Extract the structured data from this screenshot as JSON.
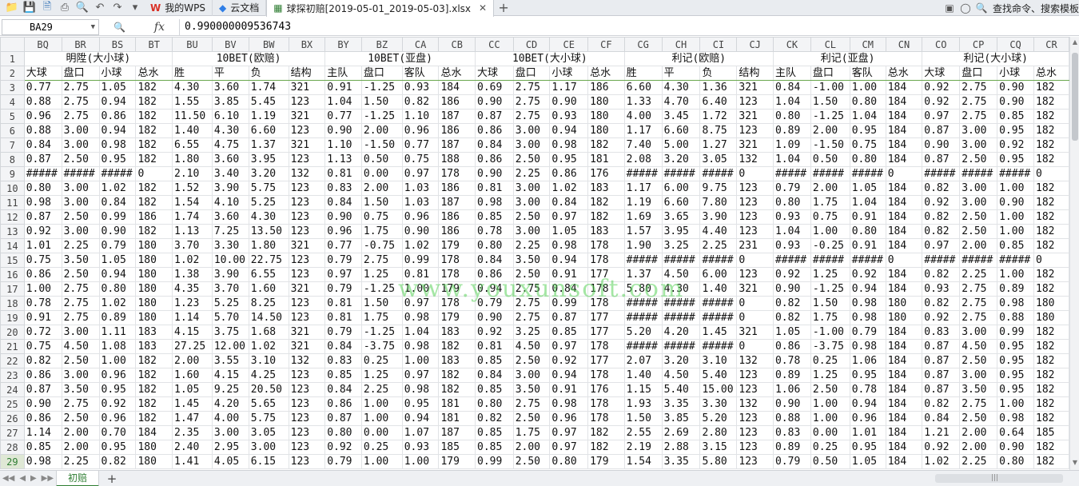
{
  "titlebar": {
    "tabs": [
      {
        "label": "我的WPS",
        "icon": "wps-logo-icon"
      },
      {
        "label": "云文档",
        "icon": "cloud-doc-icon"
      },
      {
        "label": "球探初赔[2019-05-01_2019-05-03].xlsx",
        "icon": "excel-file-icon"
      }
    ],
    "search_label": "查找命令、搜索模板"
  },
  "formula_bar": {
    "cell_ref": "BA29",
    "fx": "fx",
    "content": "0.990000009536743"
  },
  "sheet": {
    "columns": [
      "BQ",
      "BR",
      "BS",
      "BT",
      "BU",
      "BV",
      "BW",
      "BX",
      "BY",
      "BZ",
      "CA",
      "CB",
      "CC",
      "CD",
      "CE",
      "CF",
      "CG",
      "CH",
      "CI",
      "CJ",
      "CK",
      "CL",
      "CM",
      "CN",
      "CO",
      "CP",
      "CQ",
      "CR"
    ],
    "col_widths": [
      47,
      47,
      46,
      46,
      50,
      46,
      50,
      46,
      46,
      51,
      46,
      46,
      48,
      46,
      48,
      46,
      47,
      48,
      46,
      46,
      47,
      49,
      45,
      46,
      47,
      47,
      46,
      44
    ],
    "row1": [
      {
        "label": "明陞(大小球)",
        "span": 4
      },
      {
        "label": "10BET(欧赔)",
        "span": 4
      },
      {
        "label": "10BET(亚盘)",
        "span": 4
      },
      {
        "label": "10BET(大小球)",
        "span": 4
      },
      {
        "label": "利记(欧赔)",
        "span": 4
      },
      {
        "label": "利记(亚盘)",
        "span": 4
      },
      {
        "label": "利记(大小球)",
        "span": 4
      }
    ],
    "row2": [
      "大球",
      "盘口",
      "小球",
      "总水",
      "胜",
      "平",
      "负",
      "结构",
      "主队",
      "盘口",
      "客队",
      "总水",
      "大球",
      "盘口",
      "小球",
      "总水",
      "胜",
      "平",
      "负",
      "结构",
      "主队",
      "盘口",
      "客队",
      "总水",
      "大球",
      "盘口",
      "小球",
      "总水"
    ],
    "rows": [
      {
        "n": 3,
        "cells": [
          "0.77",
          "2.75",
          "1.05",
          "182",
          "4.30",
          "3.60",
          "1.74",
          "321",
          "0.91",
          "-1.25",
          "0.93",
          "184",
          "0.69",
          "2.75",
          "1.17",
          "186",
          "6.60",
          "4.30",
          "1.36",
          "321",
          "0.84",
          "-1.00",
          "1.00",
          "184",
          "0.92",
          "2.75",
          "0.90",
          "182"
        ]
      },
      {
        "n": 4,
        "cells": [
          "0.88",
          "2.75",
          "0.94",
          "182",
          "1.55",
          "3.85",
          "5.45",
          "123",
          "1.04",
          "1.50",
          "0.82",
          "186",
          "0.90",
          "2.75",
          "0.90",
          "180",
          "1.33",
          "4.70",
          "6.40",
          "123",
          "1.04",
          "1.50",
          "0.80",
          "184",
          "0.92",
          "2.75",
          "0.90",
          "182"
        ]
      },
      {
        "n": 5,
        "cells": [
          "0.96",
          "2.75",
          "0.86",
          "182",
          "11.50",
          "6.10",
          "1.19",
          "321",
          "0.77",
          "-1.25",
          "1.10",
          "187",
          "0.87",
          "2.75",
          "0.93",
          "180",
          "4.00",
          "3.45",
          "1.72",
          "321",
          "0.80",
          "-1.25",
          "1.04",
          "184",
          "0.97",
          "2.75",
          "0.85",
          "182"
        ]
      },
      {
        "n": 6,
        "cells": [
          "0.88",
          "3.00",
          "0.94",
          "182",
          "1.40",
          "4.30",
          "6.60",
          "123",
          "0.90",
          "2.00",
          "0.96",
          "186",
          "0.86",
          "3.00",
          "0.94",
          "180",
          "1.17",
          "6.60",
          "8.75",
          "123",
          "0.89",
          "2.00",
          "0.95",
          "184",
          "0.87",
          "3.00",
          "0.95",
          "182"
        ]
      },
      {
        "n": 7,
        "cells": [
          "0.84",
          "3.00",
          "0.98",
          "182",
          "6.55",
          "4.75",
          "1.37",
          "321",
          "1.10",
          "-1.50",
          "0.77",
          "187",
          "0.84",
          "3.00",
          "0.98",
          "182",
          "7.40",
          "5.00",
          "1.27",
          "321",
          "1.09",
          "-1.50",
          "0.75",
          "184",
          "0.90",
          "3.00",
          "0.92",
          "182"
        ]
      },
      {
        "n": 8,
        "cells": [
          "0.87",
          "2.50",
          "0.95",
          "182",
          "1.80",
          "3.60",
          "3.95",
          "123",
          "1.13",
          "0.50",
          "0.75",
          "188",
          "0.86",
          "2.50",
          "0.95",
          "181",
          "2.08",
          "3.20",
          "3.05",
          "132",
          "1.04",
          "0.50",
          "0.80",
          "184",
          "0.87",
          "2.50",
          "0.95",
          "182"
        ]
      },
      {
        "n": 9,
        "cells": [
          "#####",
          "#####",
          "#####",
          "0",
          "2.10",
          "3.40",
          "3.20",
          "132",
          "0.81",
          "0.00",
          "0.97",
          "178",
          "0.90",
          "2.25",
          "0.86",
          "176",
          "#####",
          "#####",
          "#####",
          "0",
          "#####",
          "#####",
          "#####",
          "0",
          "#####",
          "#####",
          "#####",
          "0"
        ]
      },
      {
        "n": 10,
        "cells": [
          "0.80",
          "3.00",
          "1.02",
          "182",
          "1.52",
          "3.90",
          "5.75",
          "123",
          "0.83",
          "2.00",
          "1.03",
          "186",
          "0.81",
          "3.00",
          "1.02",
          "183",
          "1.17",
          "6.00",
          "9.75",
          "123",
          "0.79",
          "2.00",
          "1.05",
          "184",
          "0.82",
          "3.00",
          "1.00",
          "182"
        ]
      },
      {
        "n": 11,
        "cells": [
          "0.98",
          "3.00",
          "0.84",
          "182",
          "1.54",
          "4.10",
          "5.25",
          "123",
          "0.84",
          "1.50",
          "1.03",
          "187",
          "0.98",
          "3.00",
          "0.84",
          "182",
          "1.19",
          "6.60",
          "7.80",
          "123",
          "0.80",
          "1.75",
          "1.04",
          "184",
          "0.92",
          "3.00",
          "0.90",
          "182"
        ]
      },
      {
        "n": 12,
        "cells": [
          "0.87",
          "2.50",
          "0.99",
          "186",
          "1.74",
          "3.60",
          "4.30",
          "123",
          "0.90",
          "0.75",
          "0.96",
          "186",
          "0.85",
          "2.50",
          "0.97",
          "182",
          "1.69",
          "3.65",
          "3.90",
          "123",
          "0.93",
          "0.75",
          "0.91",
          "184",
          "0.82",
          "2.50",
          "1.00",
          "182"
        ]
      },
      {
        "n": 13,
        "cells": [
          "0.92",
          "3.00",
          "0.90",
          "182",
          "1.13",
          "7.25",
          "13.50",
          "123",
          "0.96",
          "1.75",
          "0.90",
          "186",
          "0.78",
          "3.00",
          "1.05",
          "183",
          "1.57",
          "3.95",
          "4.40",
          "123",
          "1.04",
          "1.00",
          "0.80",
          "184",
          "0.82",
          "2.50",
          "1.00",
          "182"
        ]
      },
      {
        "n": 14,
        "cells": [
          "1.01",
          "2.25",
          "0.79",
          "180",
          "3.70",
          "3.30",
          "1.80",
          "321",
          "0.77",
          "-0.75",
          "1.02",
          "179",
          "0.80",
          "2.25",
          "0.98",
          "178",
          "1.90",
          "3.25",
          "2.25",
          "231",
          "0.93",
          "-0.25",
          "0.91",
          "184",
          "0.97",
          "2.00",
          "0.85",
          "182"
        ]
      },
      {
        "n": 15,
        "cells": [
          "0.75",
          "3.50",
          "1.05",
          "180",
          "1.02",
          "10.00",
          "22.75",
          "123",
          "0.79",
          "2.75",
          "0.99",
          "178",
          "0.84",
          "3.50",
          "0.94",
          "178",
          "#####",
          "#####",
          "#####",
          "0",
          "#####",
          "#####",
          "#####",
          "0",
          "#####",
          "#####",
          "#####",
          "0"
        ]
      },
      {
        "n": 16,
        "cells": [
          "0.86",
          "2.50",
          "0.94",
          "180",
          "1.38",
          "3.90",
          "6.55",
          "123",
          "0.97",
          "1.25",
          "0.81",
          "178",
          "0.86",
          "2.50",
          "0.91",
          "177",
          "1.37",
          "4.50",
          "6.00",
          "123",
          "0.92",
          "1.25",
          "0.92",
          "184",
          "0.82",
          "2.25",
          "1.00",
          "182"
        ]
      },
      {
        "n": 17,
        "cells": [
          "1.00",
          "2.75",
          "0.80",
          "180",
          "4.35",
          "3.70",
          "1.60",
          "321",
          "0.79",
          "-1.25",
          "1.00",
          "179",
          "0.94",
          "2.75",
          "0.84",
          "178",
          "5.80",
          "4.30",
          "1.40",
          "321",
          "0.90",
          "-1.25",
          "0.94",
          "184",
          "0.93",
          "2.75",
          "0.89",
          "182"
        ]
      },
      {
        "n": 18,
        "cells": [
          "0.78",
          "2.75",
          "1.02",
          "180",
          "1.23",
          "5.25",
          "8.25",
          "123",
          "0.81",
          "1.50",
          "0.97",
          "178",
          "0.79",
          "2.75",
          "0.99",
          "178",
          "#####",
          "#####",
          "#####",
          "0",
          "0.82",
          "1.50",
          "0.98",
          "180",
          "0.82",
          "2.75",
          "0.98",
          "180"
        ]
      },
      {
        "n": 19,
        "cells": [
          "0.91",
          "2.75",
          "0.89",
          "180",
          "1.14",
          "5.70",
          "14.50",
          "123",
          "0.81",
          "1.75",
          "0.98",
          "179",
          "0.90",
          "2.75",
          "0.87",
          "177",
          "#####",
          "#####",
          "#####",
          "0",
          "0.82",
          "1.75",
          "0.98",
          "180",
          "0.92",
          "2.75",
          "0.88",
          "180"
        ]
      },
      {
        "n": 20,
        "cells": [
          "0.72",
          "3.00",
          "1.11",
          "183",
          "4.15",
          "3.75",
          "1.68",
          "321",
          "0.79",
          "-1.25",
          "1.04",
          "183",
          "0.92",
          "3.25",
          "0.85",
          "177",
          "5.20",
          "4.20",
          "1.45",
          "321",
          "1.05",
          "-1.00",
          "0.79",
          "184",
          "0.83",
          "3.00",
          "0.99",
          "182"
        ]
      },
      {
        "n": 21,
        "cells": [
          "0.75",
          "4.50",
          "1.08",
          "183",
          "27.25",
          "12.00",
          "1.02",
          "321",
          "0.84",
          "-3.75",
          "0.98",
          "182",
          "0.81",
          "4.50",
          "0.97",
          "178",
          "#####",
          "#####",
          "#####",
          "0",
          "0.86",
          "-3.75",
          "0.98",
          "184",
          "0.87",
          "4.50",
          "0.95",
          "182"
        ]
      },
      {
        "n": 22,
        "cells": [
          "0.82",
          "2.50",
          "1.00",
          "182",
          "2.00",
          "3.55",
          "3.10",
          "132",
          "0.83",
          "0.25",
          "1.00",
          "183",
          "0.85",
          "2.50",
          "0.92",
          "177",
          "2.07",
          "3.20",
          "3.10",
          "132",
          "0.78",
          "0.25",
          "1.06",
          "184",
          "0.87",
          "2.50",
          "0.95",
          "182"
        ]
      },
      {
        "n": 23,
        "cells": [
          "0.86",
          "3.00",
          "0.96",
          "182",
          "1.60",
          "4.15",
          "4.25",
          "123",
          "0.85",
          "1.25",
          "0.97",
          "182",
          "0.84",
          "3.00",
          "0.94",
          "178",
          "1.40",
          "4.50",
          "5.40",
          "123",
          "0.89",
          "1.25",
          "0.95",
          "184",
          "0.87",
          "3.00",
          "0.95",
          "182"
        ]
      },
      {
        "n": 24,
        "cells": [
          "0.87",
          "3.50",
          "0.95",
          "182",
          "1.05",
          "9.25",
          "20.50",
          "123",
          "0.84",
          "2.25",
          "0.98",
          "182",
          "0.85",
          "3.50",
          "0.91",
          "176",
          "1.15",
          "5.40",
          "15.00",
          "123",
          "1.06",
          "2.50",
          "0.78",
          "184",
          "0.87",
          "3.50",
          "0.95",
          "182"
        ]
      },
      {
        "n": 25,
        "cells": [
          "0.90",
          "2.75",
          "0.92",
          "182",
          "1.45",
          "4.20",
          "5.65",
          "123",
          "0.86",
          "1.00",
          "0.95",
          "181",
          "0.80",
          "2.75",
          "0.98",
          "178",
          "1.93",
          "3.35",
          "3.30",
          "132",
          "0.90",
          "1.00",
          "0.94",
          "184",
          "0.82",
          "2.75",
          "1.00",
          "182"
        ]
      },
      {
        "n": 26,
        "cells": [
          "0.86",
          "2.50",
          "0.96",
          "182",
          "1.47",
          "4.00",
          "5.75",
          "123",
          "0.87",
          "1.00",
          "0.94",
          "181",
          "0.82",
          "2.50",
          "0.96",
          "178",
          "1.50",
          "3.85",
          "5.20",
          "123",
          "0.88",
          "1.00",
          "0.96",
          "184",
          "0.84",
          "2.50",
          "0.98",
          "182"
        ]
      },
      {
        "n": 27,
        "cells": [
          "1.14",
          "2.00",
          "0.70",
          "184",
          "2.35",
          "3.00",
          "3.05",
          "123",
          "0.80",
          "0.00",
          "1.07",
          "187",
          "0.85",
          "1.75",
          "0.97",
          "182",
          "2.55",
          "2.69",
          "2.80",
          "123",
          "0.83",
          "0.00",
          "1.01",
          "184",
          "1.21",
          "2.00",
          "0.64",
          "185"
        ]
      },
      {
        "n": 28,
        "cells": [
          "0.85",
          "2.00",
          "0.95",
          "180",
          "2.40",
          "2.95",
          "3.00",
          "123",
          "0.92",
          "0.25",
          "0.93",
          "185",
          "0.85",
          "2.00",
          "0.97",
          "182",
          "2.19",
          "2.88",
          "3.15",
          "123",
          "0.89",
          "0.25",
          "0.95",
          "184",
          "0.92",
          "2.00",
          "0.90",
          "182"
        ]
      },
      {
        "n": 29,
        "cells": [
          "0.98",
          "2.25",
          "0.82",
          "180",
          "1.41",
          "4.05",
          "6.15",
          "123",
          "0.79",
          "1.00",
          "1.00",
          "179",
          "0.99",
          "2.50",
          "0.80",
          "179",
          "1.54",
          "3.35",
          "5.80",
          "123",
          "0.79",
          "0.50",
          "1.05",
          "184",
          "1.02",
          "2.25",
          "0.80",
          "182"
        ]
      }
    ]
  },
  "watermark": "www.youxunsoft.com",
  "sheetbar": {
    "tab_label": "初赔",
    "add_label": "+"
  },
  "colors": {
    "accent": "#2e7d32",
    "header_bg": "#f3f4f6",
    "grid_line": "#e1e3e6"
  }
}
